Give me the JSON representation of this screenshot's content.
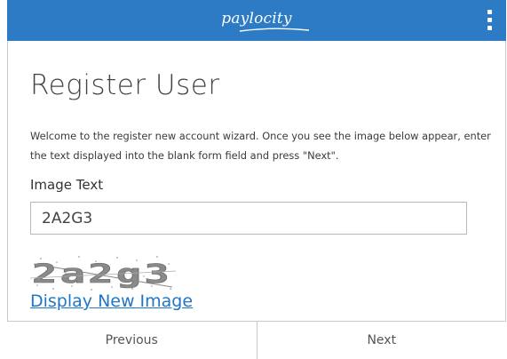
{
  "header": {
    "logo_text": "paylocity",
    "menu_icon": "kebab-menu-icon"
  },
  "page": {
    "title": "Register User",
    "description": "Welcome to the register new account wizard. Once you see the image below appear, enter the text displayed into the blank form field and press \"Next\"."
  },
  "form": {
    "image_text_label": "Image Text",
    "image_text_value": "2A2G3",
    "captcha_text": "2a2g3",
    "new_image_link": "Display New Image"
  },
  "footer": {
    "previous_label": "Previous",
    "next_label": "Next"
  },
  "colors": {
    "header_bg": "#2d7ac5",
    "link": "#1f76c8"
  }
}
